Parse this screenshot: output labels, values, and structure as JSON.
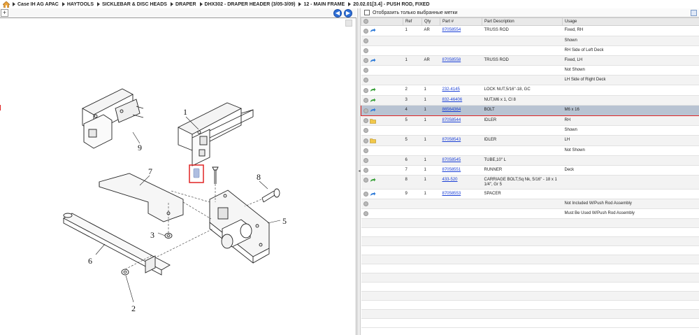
{
  "breadcrumb": [
    "Case IH AG APAC",
    "HAYTOOLS",
    "SICKLEBAR & DISC HEADS",
    "DRAPER",
    "DHX302 - DRAPER HEADER (3/05-3/09)",
    "12 - MAIN FRAME",
    "20.02.01[3.4] - PUSH ROD, FIXED"
  ],
  "left_toolbar": {
    "expand_glyph": "+",
    "back_glyph": "◀",
    "forward_glyph": "▶"
  },
  "diagram_callouts": [
    "1",
    "2",
    "3",
    "5",
    "6",
    "7",
    "8",
    "9"
  ],
  "filter": {
    "label": "Отобразить только выбранные метки",
    "checked": false
  },
  "table": {
    "headers": [
      "",
      "Ref",
      "Qty",
      "Part #",
      "Part Description",
      "Usage"
    ],
    "rows": [
      {
        "icon": "arrow-blue",
        "ref": "1",
        "qty": "AR",
        "part": "87058554",
        "desc": "TRUSS ROD",
        "usage": "Fixed, RH"
      },
      {
        "icon": "",
        "ref": "",
        "qty": "",
        "part": "",
        "desc": "",
        "usage": "Shown"
      },
      {
        "icon": "",
        "ref": "",
        "qty": "",
        "part": "",
        "desc": "",
        "usage": "RH Side of Left Deck"
      },
      {
        "icon": "arrow-blue",
        "ref": "1",
        "qty": "AR",
        "part": "87058558",
        "desc": "TRUSS ROD",
        "usage": "Fixed, LH"
      },
      {
        "icon": "",
        "ref": "",
        "qty": "",
        "part": "",
        "desc": "",
        "usage": "Not Shown"
      },
      {
        "icon": "",
        "ref": "",
        "qty": "",
        "part": "",
        "desc": "",
        "usage": "LH Side of Right Deck"
      },
      {
        "icon": "arrow-green",
        "ref": "2",
        "qty": "1",
        "part": "232-4145",
        "desc": "LOCK NUT,5/16\"-18, GC",
        "usage": ""
      },
      {
        "icon": "arrow-green",
        "ref": "3",
        "qty": "1",
        "part": "832-46406",
        "desc": "NUT,M6 x 1, Cl 8",
        "usage": ""
      },
      {
        "icon": "arrow-blue",
        "ref": "4",
        "qty": "1",
        "part": "86564364",
        "desc": "BOLT",
        "usage": "M6 x 16",
        "selected": true
      },
      {
        "icon": "folder",
        "ref": "5",
        "qty": "1",
        "part": "87058544",
        "desc": "IDLER",
        "usage": "RH"
      },
      {
        "icon": "",
        "ref": "",
        "qty": "",
        "part": "",
        "desc": "",
        "usage": "Shown"
      },
      {
        "icon": "folder",
        "ref": "5",
        "qty": "1",
        "part": "87058543",
        "desc": "IDLER",
        "usage": "LH"
      },
      {
        "icon": "",
        "ref": "",
        "qty": "",
        "part": "",
        "desc": "",
        "usage": "Not Shown"
      },
      {
        "icon": "",
        "ref": "6",
        "qty": "1",
        "part": "87058545",
        "desc": "TUBE,10\" L",
        "usage": ""
      },
      {
        "icon": "",
        "ref": "7",
        "qty": "1",
        "part": "87058551",
        "desc": "RUNNER",
        "usage": "Deck"
      },
      {
        "icon": "arrow-green",
        "ref": "8",
        "qty": "1",
        "part": "433-520",
        "desc": "CARRIAGE BOLT,Sq Nk, 5/16\" - 18 x 1 1/4\", Gr 5",
        "usage": "",
        "tall": true
      },
      {
        "icon": "arrow-blue",
        "ref": "9",
        "qty": "1",
        "part": "87058553",
        "desc": "SPACER",
        "usage": ""
      },
      {
        "icon": "",
        "ref": "",
        "qty": "",
        "part": "",
        "desc": "",
        "usage": "Not Included W/Push Rod Assembly"
      },
      {
        "icon": "",
        "ref": "",
        "qty": "",
        "part": "",
        "desc": "",
        "usage": "Must Be Used W/Push Rod Assembly"
      }
    ]
  },
  "colors": {
    "selection_outline": "#e02424",
    "selected_row": "#b8c3d2",
    "link": "#1a3fd6",
    "nav_button": "#2e6fd6"
  }
}
